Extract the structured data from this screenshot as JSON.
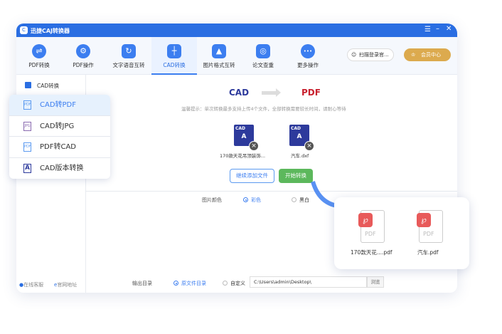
{
  "app": {
    "title": "迅捷CAJ转换器"
  },
  "toolbar": {
    "items": [
      {
        "label": "PDF转换",
        "icon": "⇌"
      },
      {
        "label": "PDF操作",
        "icon": "⚙"
      },
      {
        "label": "文字语音互转",
        "icon": "↻"
      },
      {
        "label": "CAD转换",
        "icon": "┼"
      },
      {
        "label": "图片格式互转",
        "icon": "▲"
      },
      {
        "label": "论文查重",
        "icon": "◎"
      },
      {
        "label": "更多操作",
        "icon": "•••"
      }
    ],
    "login": "扫描登录官...",
    "vip": "会员中心"
  },
  "sidebar": {
    "header": "CAD转换",
    "service": "在线客服",
    "website": "官网地址"
  },
  "menu": [
    {
      "label": "CAD转PDF",
      "icon": "PDF"
    },
    {
      "label": "CAD转JPG",
      "icon": "JPG"
    },
    {
      "label": "PDF转CAD",
      "icon": "PDF"
    },
    {
      "label": "CAD版本转换",
      "icon": "A"
    }
  ],
  "main": {
    "from": "CAD",
    "to": "PDF",
    "tip": "温馨提示：单次转换最多支持上传4个文件，全部转换需要较长时间，请耐心等待",
    "files": [
      {
        "name": "170款天花吊顶装饰..."
      },
      {
        "name": "汽车.dxf"
      }
    ],
    "add_button": "继续添加文件",
    "start_button": "开始转换",
    "color_label": "图片颜色",
    "color_options": [
      "彩色",
      "黑白"
    ],
    "output_label": "输出目录",
    "output_options": [
      "原文件目录",
      "自定义"
    ],
    "output_path": "C:\\Users\\admin\\Desktop\\",
    "browse": "浏览"
  },
  "result": {
    "files": [
      "170款天花....pdf",
      "汽车.pdf"
    ]
  }
}
